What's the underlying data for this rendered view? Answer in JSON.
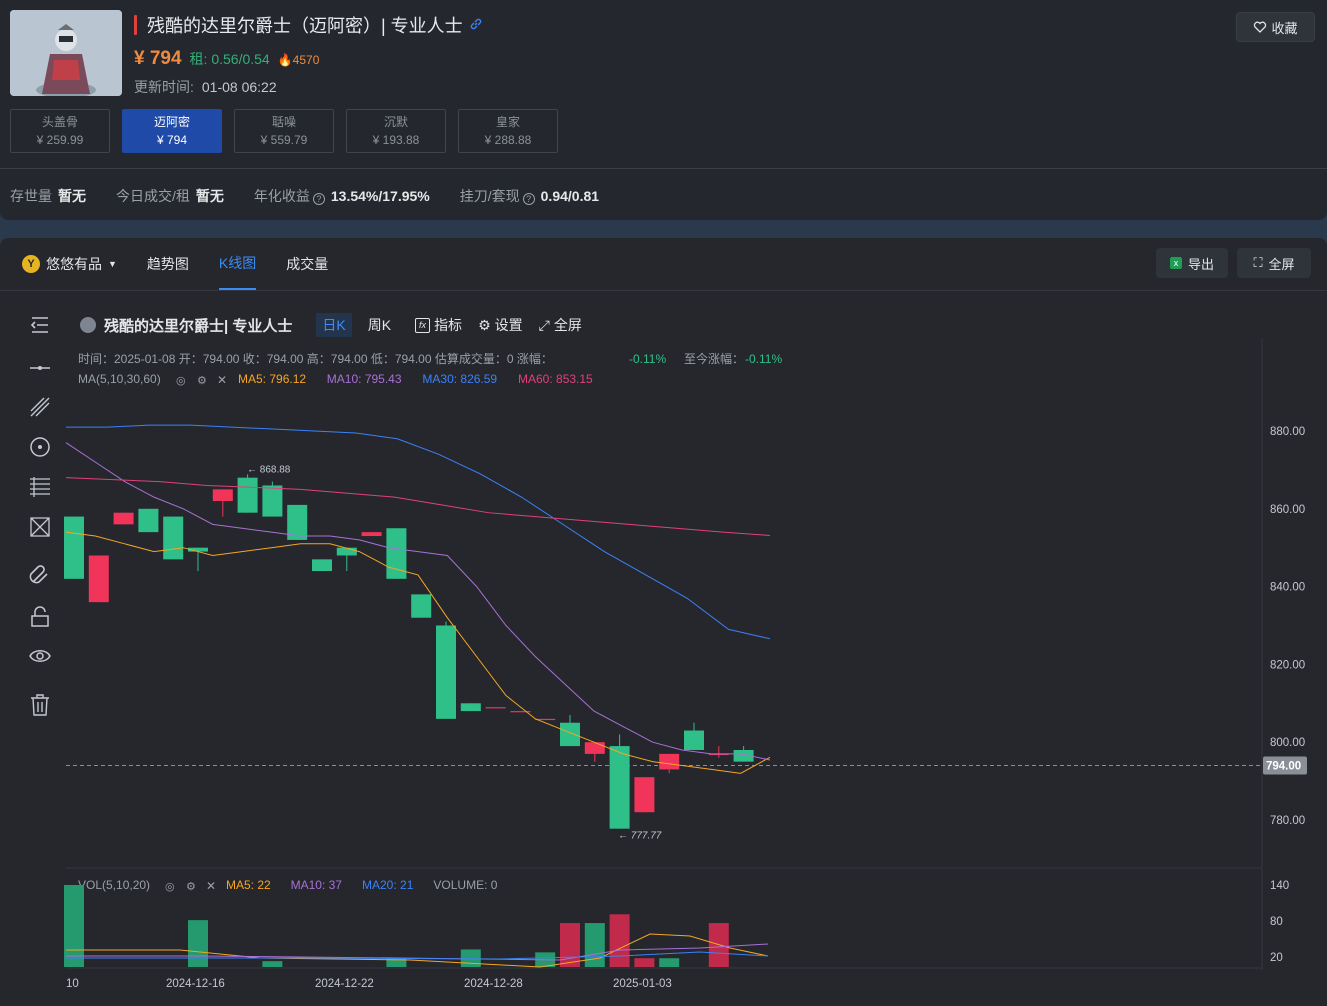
{
  "item": {
    "title": "残酷的达里尔爵士（迈阿密）| 专业人士",
    "price": "¥ 794",
    "rent": "租: 0.56/0.54",
    "heat": "4570",
    "update_label": "更新时间:",
    "update_time": "01-08 06:22",
    "favorite_label": "收藏"
  },
  "variants": [
    {
      "name": "头盖骨",
      "price": "¥ 259.99",
      "active": false
    },
    {
      "name": "迈阿密",
      "price": "¥ 794",
      "active": true
    },
    {
      "name": "聒噪",
      "price": "¥ 559.79",
      "active": false
    },
    {
      "name": "沉默",
      "price": "¥ 193.88",
      "active": false
    },
    {
      "name": "皇家",
      "price": "¥ 288.88",
      "active": false
    }
  ],
  "stats": {
    "stock_label": "存世量",
    "stock_value": "暂无",
    "deal_label": "今日成交/租",
    "deal_value": "暂无",
    "yield_label": "年化收益",
    "yield_value": "13.54%/17.95%",
    "ratio_label": "挂刀/套现",
    "ratio_value": "0.94/0.81"
  },
  "panel": {
    "brand": "悠悠有品",
    "tabs": [
      "趋势图",
      "K线图",
      "成交量"
    ],
    "active_tab": "K线图",
    "export_label": "导出",
    "fullscreen_label": "全屏"
  },
  "chart_header": {
    "symbol": "残酷的达里尔爵士| 专业人士",
    "periods": [
      "日K",
      "周K"
    ],
    "active_period": "日K",
    "indicator_label": "指标",
    "settings_label": "设置",
    "fullscreen_label": "全屏",
    "info_line": "时间：2025-01-08    开：794.00    收：794.00    高：794.00    低：794.00    估算成交量：0    涨幅：",
    "change_value": "-0.11%",
    "cum_label": "至今涨幅：",
    "cum_value": "-0.11%",
    "ma_title": "MA(5,10,30,60)",
    "ma_values": [
      {
        "label": "MA5: 796.12",
        "color": "#f5a623"
      },
      {
        "label": "MA10: 795.43",
        "color": "#a970d6"
      },
      {
        "label": "MA30: 826.59",
        "color": "#3b82f6"
      },
      {
        "label": "MA60: 853.15",
        "color": "#e0417a"
      }
    ],
    "vol_title": "VOL(5,10,20)",
    "vol_values": [
      {
        "label": "MA5: 22",
        "color": "#f5a623"
      },
      {
        "label": "MA10: 37",
        "color": "#a970d6"
      },
      {
        "label": "MA20: 21",
        "color": "#3b82f6"
      },
      {
        "label": "VOLUME: 0",
        "color": "#9aa0a8"
      }
    ]
  },
  "colors": {
    "up": "#f0345a",
    "down": "#2fc08a",
    "ma5": "#f5a623",
    "ma10": "#a970d6",
    "ma30": "#3b82f6",
    "ma60": "#e0417a"
  },
  "chart_data": {
    "type": "candlestick",
    "y_ticks": [
      "880.00",
      "860.00",
      "840.00",
      "820.00",
      "800.00",
      "780.00"
    ],
    "ylim": [
      770,
      893
    ],
    "current_price": "794.00",
    "x_tick_labels": [
      "10",
      "2024-12-16",
      "2024-12-22",
      "2024-12-28",
      "2025-01-03"
    ],
    "high_label": "868.88",
    "low_label": "777.77",
    "candles": [
      {
        "o": 858,
        "c": 842,
        "h": 858,
        "l": 842
      },
      {
        "o": 836,
        "c": 848,
        "h": 848,
        "l": 836
      },
      {
        "o": 856,
        "c": 859,
        "h": 859,
        "l": 856
      },
      {
        "o": 860,
        "c": 854,
        "h": 860,
        "l": 854
      },
      {
        "o": 858,
        "c": 847,
        "h": 858,
        "l": 847
      },
      {
        "o": 850,
        "c": 849,
        "h": 850,
        "l": 844
      },
      {
        "o": 862,
        "c": 865,
        "h": 865,
        "l": 858
      },
      {
        "o": 868,
        "c": 859,
        "h": 868.88,
        "l": 859
      },
      {
        "o": 866,
        "c": 858,
        "h": 867,
        "l": 858
      },
      {
        "o": 861,
        "c": 852,
        "h": 861,
        "l": 852
      },
      {
        "o": 847,
        "c": 844,
        "h": 847,
        "l": 844
      },
      {
        "o": 850,
        "c": 848,
        "h": 850,
        "l": 844
      },
      {
        "o": 853,
        "c": 854,
        "h": 854,
        "l": 853
      },
      {
        "o": 855,
        "c": 842,
        "h": 855,
        "l": 842
      },
      {
        "o": 838,
        "c": 832,
        "h": 838,
        "l": 832
      },
      {
        "o": 830,
        "c": 806,
        "h": 831,
        "l": 806
      },
      {
        "o": 810,
        "c": 808,
        "h": 810,
        "l": 808
      },
      {
        "o": 809,
        "c": 809,
        "h": 809,
        "l": 809
      },
      {
        "o": 808,
        "c": 808,
        "h": 808,
        "l": 808
      },
      {
        "o": 806,
        "c": 806,
        "h": 806,
        "l": 806
      },
      {
        "o": 805,
        "c": 799,
        "h": 807,
        "l": 799
      },
      {
        "o": 797,
        "c": 800,
        "h": 800,
        "l": 795
      },
      {
        "o": 799,
        "c": 777.77,
        "h": 802,
        "l": 777.77
      },
      {
        "o": 782,
        "c": 791,
        "h": 791,
        "l": 782
      },
      {
        "o": 793,
        "c": 797,
        "h": 797,
        "l": 792
      },
      {
        "o": 803,
        "c": 798,
        "h": 805,
        "l": 798
      },
      {
        "o": 797,
        "c": 797,
        "h": 799,
        "l": 796
      },
      {
        "o": 798,
        "c": 795,
        "h": 799,
        "l": 795
      }
    ],
    "ma5": [
      854,
      853,
      851,
      849,
      850,
      848,
      849,
      850,
      851,
      851,
      849,
      845,
      843,
      832,
      822,
      812,
      806,
      803,
      800,
      797,
      795,
      794,
      793,
      792,
      796.12
    ],
    "ma10": [
      877,
      872,
      867,
      863,
      860,
      856,
      855,
      854,
      853,
      853,
      852,
      850,
      849,
      848,
      840,
      830,
      822,
      815,
      808,
      804,
      800,
      798,
      797,
      797,
      795.43
    ],
    "ma30": [
      881,
      881,
      881.5,
      881.5,
      881,
      880.5,
      880,
      879.5,
      878,
      874,
      869,
      863,
      856,
      849,
      843,
      837,
      829,
      826.59
    ],
    "ma60": [
      868,
      867.5,
      867,
      866,
      865.5,
      865,
      864,
      863,
      861,
      859,
      858,
      857,
      856,
      855,
      854,
      853.15
    ],
    "volume": [
      140,
      0,
      0,
      0,
      80,
      0,
      0,
      0,
      10,
      0,
      0,
      0,
      15,
      0,
      0,
      0,
      0,
      0,
      30,
      0,
      0,
      0,
      0,
      0,
      25,
      75,
      75,
      90,
      15,
      0,
      15,
      0,
      75
    ],
    "vol_ticks": [
      "140",
      "80",
      "20"
    ]
  }
}
